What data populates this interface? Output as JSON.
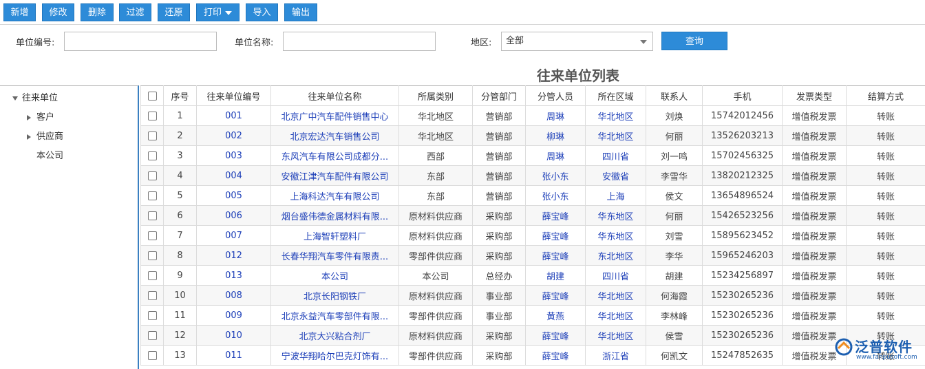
{
  "toolbar": {
    "buttons": [
      "新增",
      "修改",
      "删除",
      "过滤",
      "还原",
      "打印",
      "导入",
      "输出"
    ]
  },
  "filter": {
    "code_label": "单位编号:",
    "code_value": "",
    "name_label": "单位名称:",
    "name_value": "",
    "region_label": "地区:",
    "region_value": "全部",
    "query_label": "查询"
  },
  "table_title": "往来单位列表",
  "tree": {
    "root": "往来单位",
    "children": [
      "客户",
      "供应商",
      "本公司"
    ]
  },
  "columns": [
    "序号",
    "往来单位编号",
    "往来单位名称",
    "所属类别",
    "分管部门",
    "分管人员",
    "所在区域",
    "联系人",
    "手机",
    "发票类型",
    "结算方式"
  ],
  "rows": [
    [
      "1",
      "001",
      "北京广中汽车配件销售中心",
      "华北地区",
      "营销部",
      "周琳",
      "华北地区",
      "刘焕",
      "15742012456",
      "增值税发票",
      "转账"
    ],
    [
      "2",
      "002",
      "北京宏达汽车销售公司",
      "华北地区",
      "营销部",
      "柳琳",
      "华北地区",
      "何丽",
      "13526203213",
      "增值税发票",
      "转账"
    ],
    [
      "3",
      "003",
      "东风汽车有限公司成都分...",
      "西部",
      "营销部",
      "周琳",
      "四川省",
      "刘一鸣",
      "15702456325",
      "增值税发票",
      "转账"
    ],
    [
      "4",
      "004",
      "安徽江津汽车配件有限公司",
      "东部",
      "营销部",
      "张小东",
      "安徽省",
      "李雪华",
      "13820212325",
      "增值税发票",
      "转账"
    ],
    [
      "5",
      "005",
      "上海科达汽车有限公司",
      "东部",
      "营销部",
      "张小东",
      "上海",
      "侯文",
      "13654896524",
      "增值税发票",
      "转账"
    ],
    [
      "6",
      "006",
      "烟台盛伟德金属材料有限...",
      "原材料供应商",
      "采购部",
      "薛宝峰",
      "华东地区",
      "何丽",
      "15426523256",
      "增值税发票",
      "转账"
    ],
    [
      "7",
      "007",
      "上海智轩塑料厂",
      "原材料供应商",
      "采购部",
      "薛宝峰",
      "华东地区",
      "刘雪",
      "15895623452",
      "增值税发票",
      "转账"
    ],
    [
      "8",
      "012",
      "长春华翔汽车零件有限责...",
      "零部件供应商",
      "采购部",
      "薛宝峰",
      "东北地区",
      "李华",
      "15965246203",
      "增值税发票",
      "转账"
    ],
    [
      "9",
      "013",
      "本公司",
      "本公司",
      "总经办",
      "胡建",
      "四川省",
      "胡建",
      "15234256897",
      "增值税发票",
      "转账"
    ],
    [
      "10",
      "008",
      "北京长阳钢铁厂",
      "原材料供应商",
      "事业部",
      "薛宝峰",
      "华北地区",
      "何海霞",
      "15230265236",
      "增值税发票",
      "转账"
    ],
    [
      "11",
      "009",
      "北京永益汽车零部件有限...",
      "零部件供应商",
      "事业部",
      "黄燕",
      "华北地区",
      "李林峰",
      "15230265236",
      "增值税发票",
      "转账"
    ],
    [
      "12",
      "010",
      "北京大兴粘合剂厂",
      "原材料供应商",
      "采购部",
      "薛宝峰",
      "华北地区",
      "侯雪",
      "15230265236",
      "增值税发票",
      "转账"
    ],
    [
      "13",
      "011",
      "宁波华翔哈尔巴克灯饰有...",
      "零部件供应商",
      "采购部",
      "薛宝峰",
      "浙江省",
      "何凯文",
      "15247852635",
      "增值税发票",
      "转账"
    ]
  ],
  "logo": {
    "brand": "泛普软件",
    "url": "www.fanpusoft.com"
  }
}
